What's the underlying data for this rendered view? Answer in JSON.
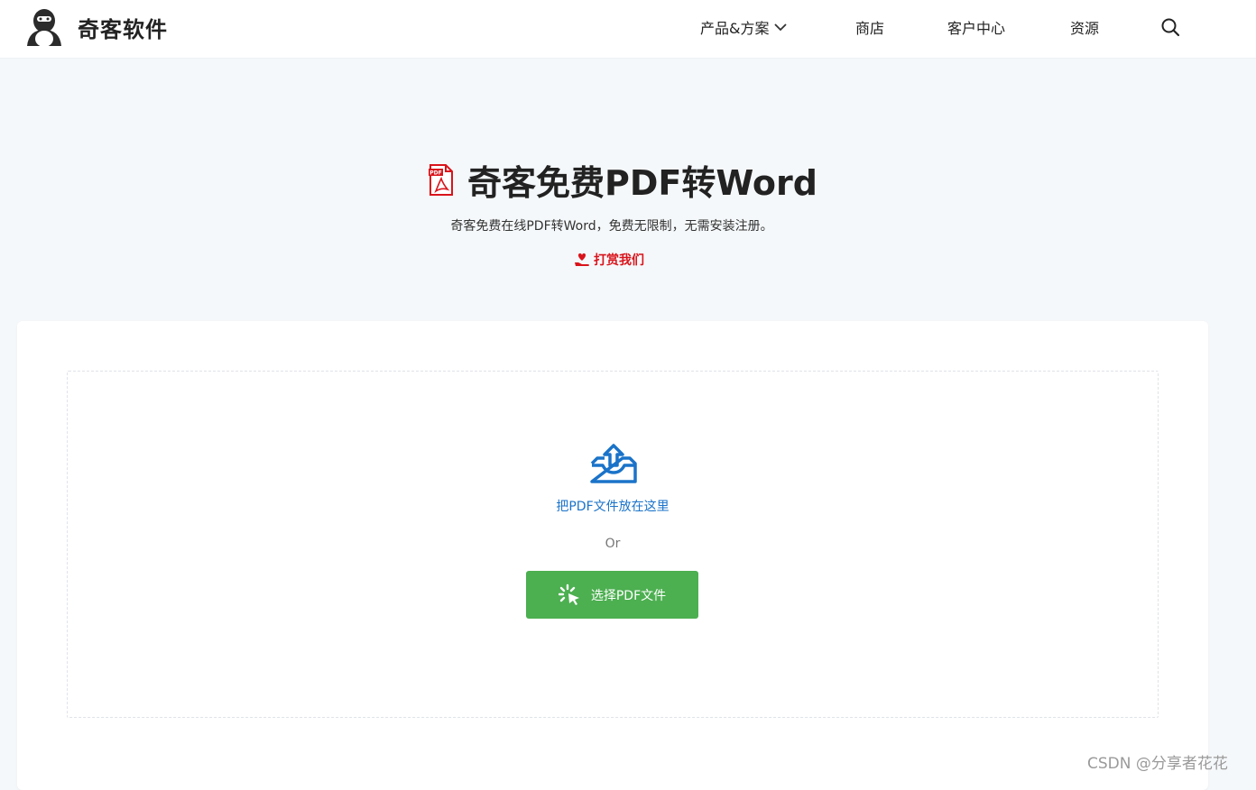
{
  "brand": {
    "name": "奇客软件",
    "logo_icon": "penguin-logo-icon"
  },
  "nav": {
    "products": "产品&方案",
    "shop": "商店",
    "client_center": "客户中心",
    "resources": "资源",
    "search_icon": "search-icon"
  },
  "hero": {
    "title": "奇客免费PDF转Word",
    "subtitle": "奇客免费在线PDF转Word，免费无限制，无需安装注册。",
    "donate_label": "打赏我们"
  },
  "upload": {
    "drop_text": "把PDF文件放在这里",
    "or_text": "Or",
    "select_button": "选择PDF文件"
  },
  "watermark": "CSDN @分享者花花",
  "colors": {
    "accent_blue": "#1a73c9",
    "button_green": "#4caf50",
    "donate_red": "#d9131b",
    "pdf_red": "#d9131b"
  }
}
